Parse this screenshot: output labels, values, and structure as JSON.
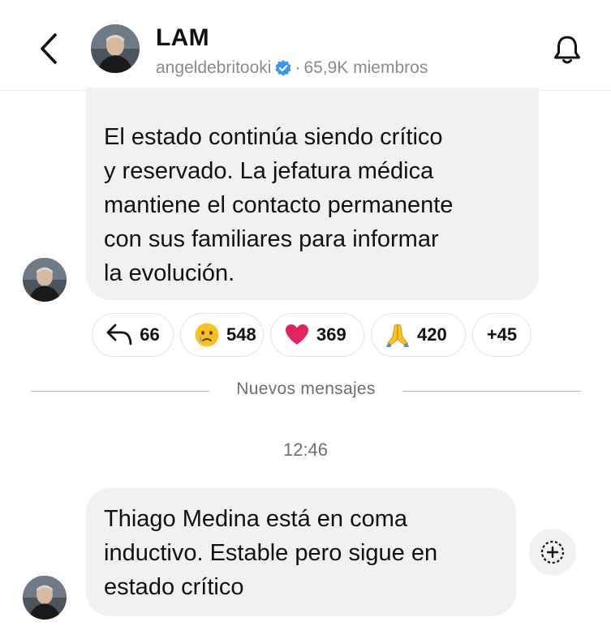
{
  "header": {
    "title": "LAM",
    "username": "angeldebritooki",
    "separator": "·",
    "members": "65,9K miembros",
    "back_icon": "chevron-left-icon",
    "bell_icon": "bell-icon",
    "verified_icon": "verified-badge-icon"
  },
  "messages": [
    {
      "text": "El estado continúa siendo crítico\ny reservado. La jefatura médica\nmantiene el contacto permanente\ncon sus familiares para informar\nla evolución."
    },
    {
      "text": "Thiago Medina está en coma\ninductivo. Estable pero sigue en\nestado crítico"
    }
  ],
  "reactions": {
    "reply_count": "66",
    "items": [
      {
        "emoji": "crying-face",
        "count": "548"
      },
      {
        "emoji": "red-heart",
        "count": "369"
      },
      {
        "emoji": "folded-hands",
        "count": "420"
      }
    ],
    "more": "+45"
  },
  "divider": {
    "label": "Nuevos mensajes"
  },
  "timestamp": "12:46",
  "colors": {
    "bubble": "#f1f1f4",
    "muted_text": "#8a8a8e",
    "verified": "#3897f0",
    "heart": "#e0245e"
  }
}
